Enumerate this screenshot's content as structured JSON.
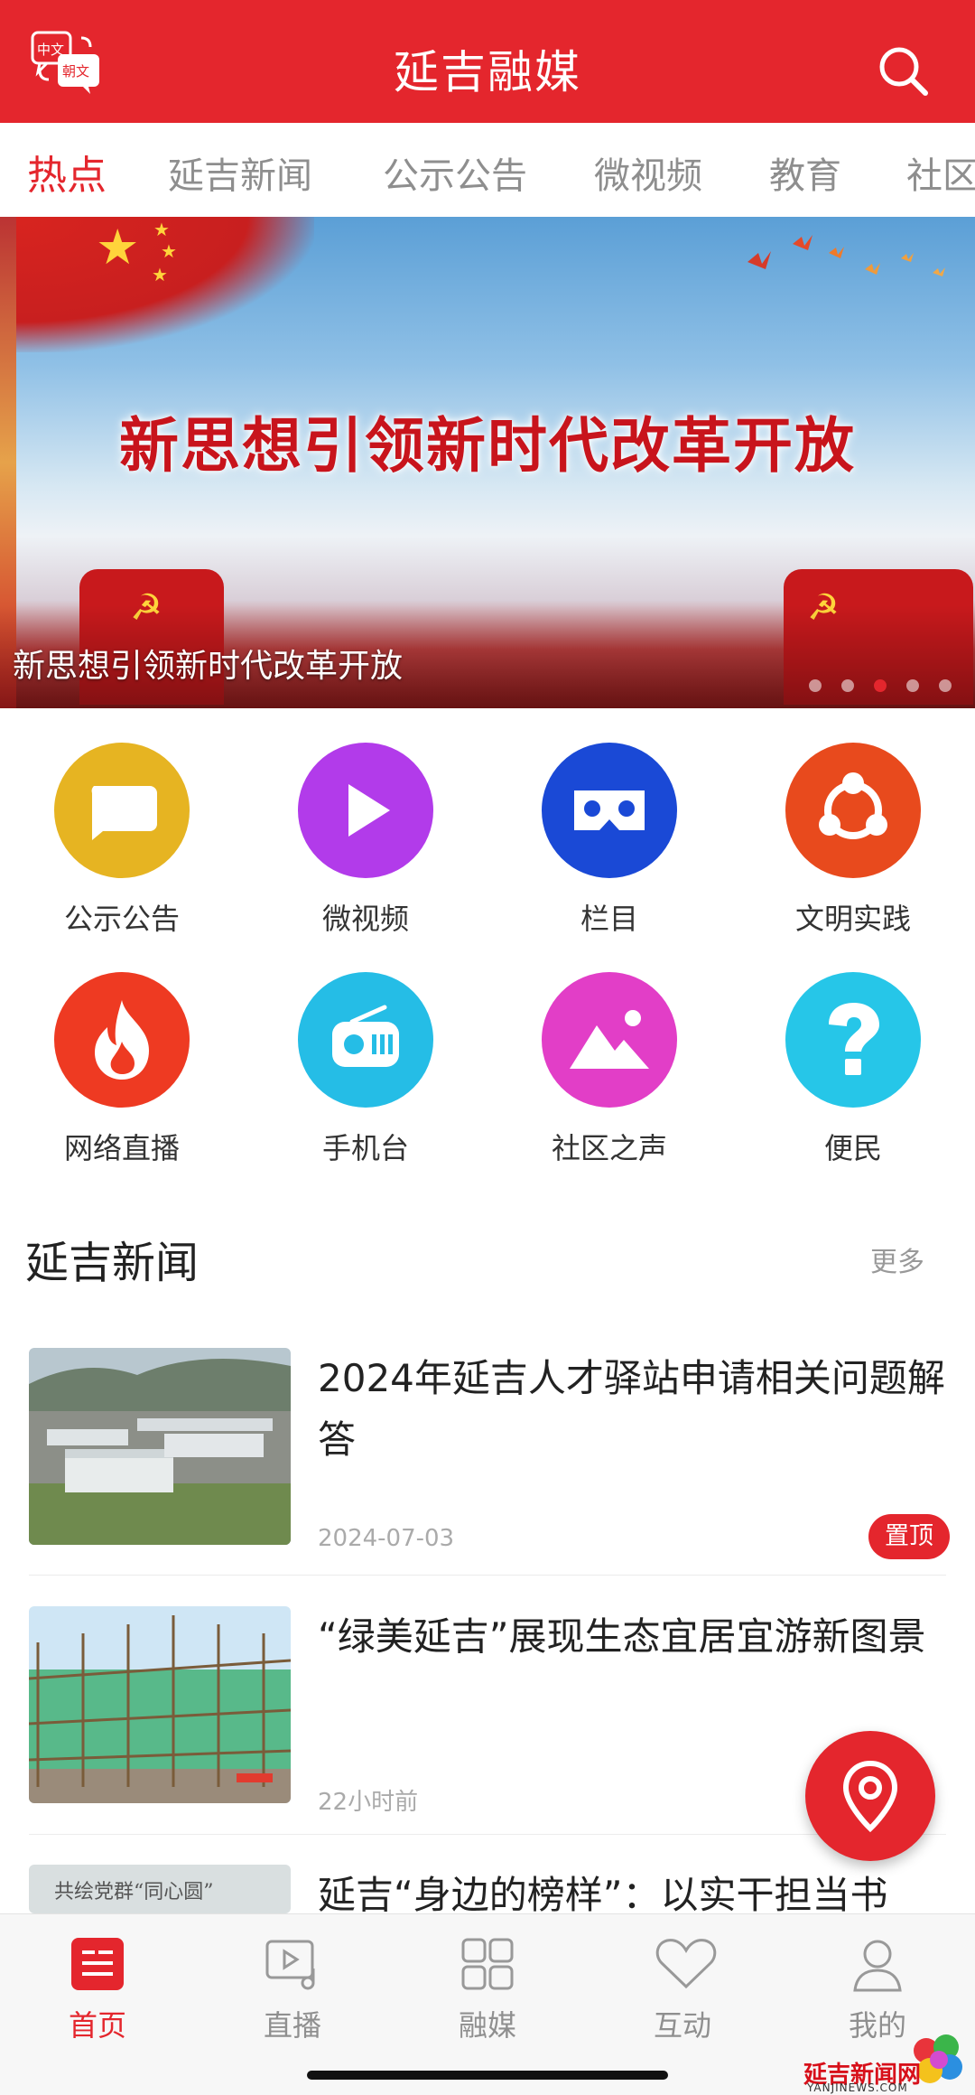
{
  "header": {
    "title": "延吉融媒",
    "lang_icon_top": "中文",
    "lang_icon_bottom": "朝文"
  },
  "tabs": [
    {
      "label": "热点",
      "active": true
    },
    {
      "label": "延吉新闻"
    },
    {
      "label": "公示公告"
    },
    {
      "label": "微视频"
    },
    {
      "label": "教育"
    },
    {
      "label": "社区"
    }
  ],
  "banner": {
    "headline": "新思想引领新时代改革开放",
    "caption": "新思想引领新时代改革开放",
    "dots": 5,
    "active_dot": 3
  },
  "grid": [
    {
      "label": "公示公告",
      "icon": "message-icon",
      "color": "#e6b422"
    },
    {
      "label": "微视频",
      "icon": "play-icon",
      "color": "#b23bea"
    },
    {
      "label": "栏目",
      "icon": "vr-glasses-icon",
      "color": "#1a49d6"
    },
    {
      "label": "文明实践",
      "icon": "share-network-icon",
      "color": "#e84a1d"
    },
    {
      "label": "网络直播",
      "icon": "flame-icon",
      "color": "#ee3a22"
    },
    {
      "label": "手机台",
      "icon": "radio-icon",
      "color": "#25bde6"
    },
    {
      "label": "社区之声",
      "icon": "mountain-image-icon",
      "color": "#e23ec7"
    },
    {
      "label": "便民",
      "icon": "question-icon",
      "color": "#26c6e8"
    }
  ],
  "section": {
    "title": "延吉新闻",
    "more": "更多"
  },
  "news": [
    {
      "title": "2024年延吉人才驿站申请相关问题解答",
      "meta": "2024-07-03",
      "badge": "置顶"
    },
    {
      "title": "“绿美延吉”展现生态宜居宜游新图景",
      "meta": "22小时前"
    },
    {
      "title": "延吉“身边的榜样”：以实干担当书",
      "thumb_text": "共绘党群“同心圆”"
    }
  ],
  "nav": [
    {
      "label": "首页",
      "icon": "home-news-icon",
      "active": true
    },
    {
      "label": "直播",
      "icon": "live-video-icon"
    },
    {
      "label": "融媒",
      "icon": "grid-apps-icon"
    },
    {
      "label": "互动",
      "icon": "heart-icon"
    },
    {
      "label": "我的",
      "icon": "user-icon"
    }
  ],
  "watermark": {
    "text": "延吉新闻网",
    "sub": "YANJINEWS.COM"
  },
  "colors": {
    "brand": "#e4262d"
  }
}
